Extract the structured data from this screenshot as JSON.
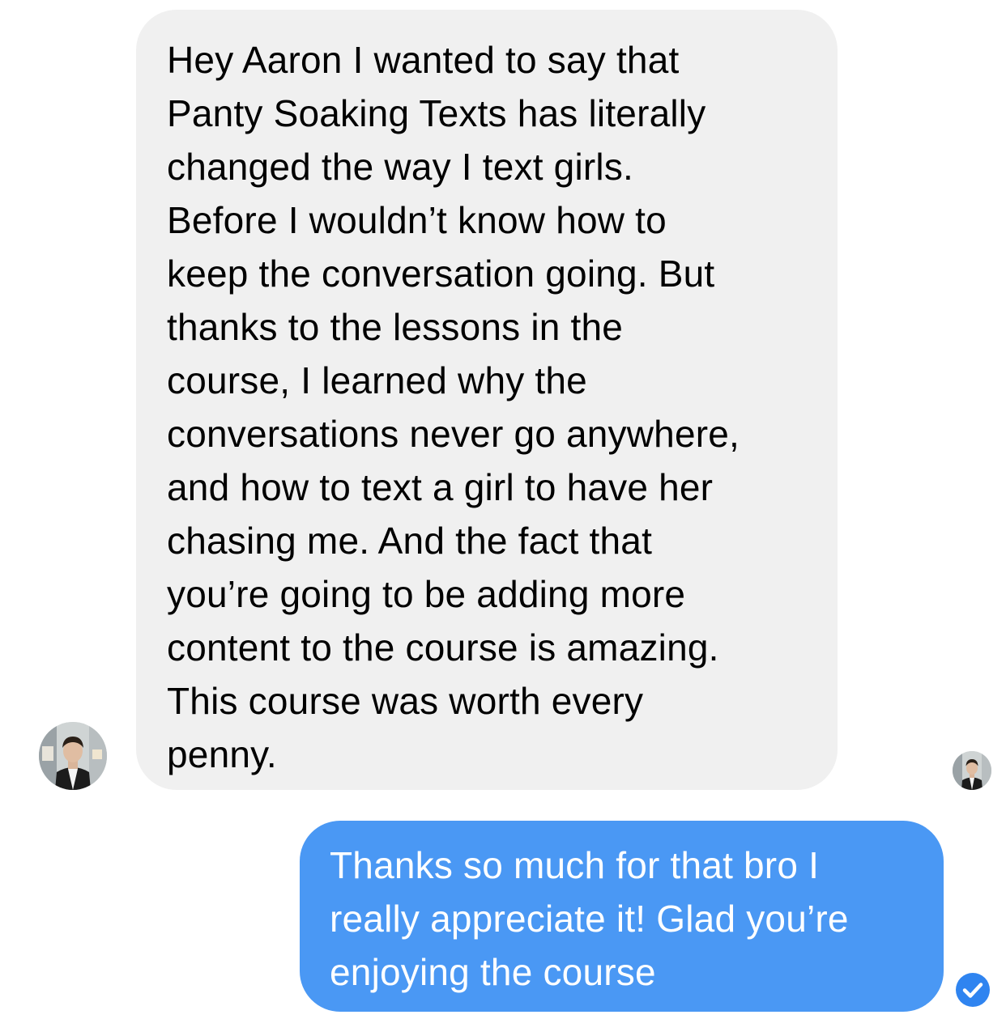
{
  "conversation": {
    "messages": [
      {
        "direction": "incoming",
        "text": "Hey Aaron I wanted to say that\nPanty Soaking Texts has literally\nchanged the way I text girls.\nBefore I wouldn’t know how to\nkeep the conversation going. But\nthanks to the lessons in the\ncourse, I learned why the\nconversations never go anywhere,\nand how to text a girl to have her\nchasing me. And the fact that\nyou’re going to be adding more\ncontent to the course is amazing.\nThis course was worth every\npenny."
      },
      {
        "direction": "outgoing",
        "text": "Thanks so much for that bro I\nreally appreciate it! Glad you’re\nenjoying the course"
      }
    ],
    "icons": {
      "sender_avatar": "avatar-photo",
      "read_receipt_avatar": "avatar-photo",
      "delivered": "check-circle-icon"
    },
    "colors": {
      "incoming_bubble": "#f0f0f0",
      "outgoing_bubble": "#4a98f4",
      "delivered_check": "#2f84f0"
    }
  }
}
